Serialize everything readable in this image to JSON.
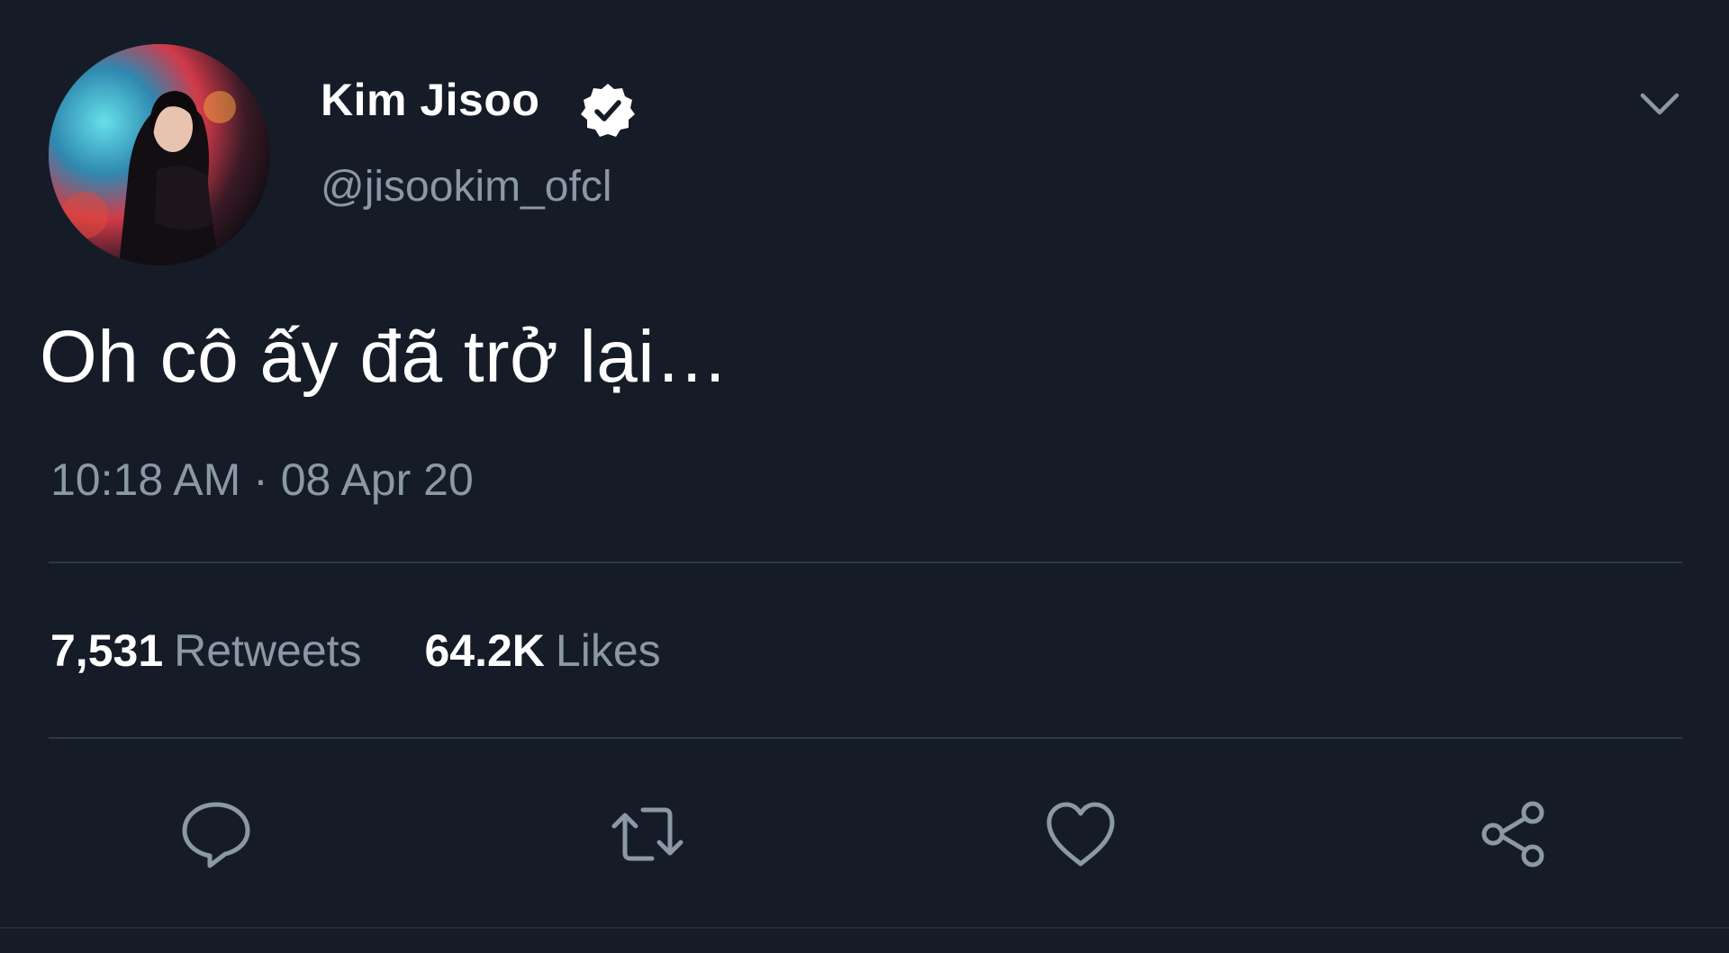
{
  "tweet": {
    "display_name": "Kim Jisoo",
    "handle": "@jisookim_ofcl",
    "text": "Oh cô ấy đã trở lại…",
    "timestamp": "10:18 AM · 08 Apr 20"
  },
  "stats": {
    "retweets_count": "7,531",
    "retweets_label": "Retweets",
    "likes_count": "64.2K",
    "likes_label": "Likes"
  },
  "icons": {
    "verified": "verified-badge-icon",
    "menu": "chevron-down-icon",
    "reply": "reply-icon",
    "retweet": "retweet-icon",
    "like": "heart-icon",
    "share": "share-icon"
  },
  "colors": {
    "background": "#151c28",
    "primary_text": "#ffffff",
    "secondary_text": "#8b98a5",
    "divider": "#2c3846"
  }
}
